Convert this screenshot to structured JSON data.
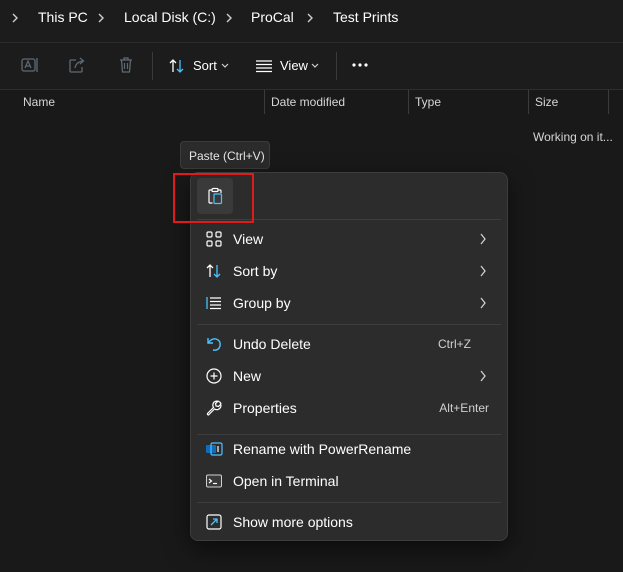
{
  "breadcrumb": {
    "items": [
      "This PC",
      "Local Disk (C:)",
      "ProCal",
      "Test Prints"
    ]
  },
  "toolbar": {
    "rename_icon": "rename-icon",
    "share_icon": "share-icon",
    "delete_icon": "delete-icon",
    "sort_label": "Sort",
    "view_label": "View",
    "more_icon": "more-icon"
  },
  "columns": {
    "name": "Name",
    "date_modified": "Date modified",
    "type": "Type",
    "size": "Size"
  },
  "status": {
    "working": "Working on it..."
  },
  "tooltip": {
    "text": "Paste (Ctrl+V)"
  },
  "context_menu": {
    "paste_icon": "paste-icon",
    "items": [
      {
        "label": "View",
        "icon": "view-grid-icon",
        "submenu": true
      },
      {
        "label": "Sort by",
        "icon": "sort-icon",
        "submenu": true
      },
      {
        "label": "Group by",
        "icon": "group-icon",
        "submenu": true
      },
      {
        "label": "Undo Delete",
        "icon": "undo-icon",
        "shortcut": "Ctrl+Z"
      },
      {
        "label": "New",
        "icon": "new-icon",
        "submenu": true
      },
      {
        "label": "Properties",
        "icon": "wrench-icon",
        "shortcut": "Alt+Enter"
      },
      {
        "label": "Rename with PowerRename",
        "icon": "powerrename-icon"
      },
      {
        "label": "Open in Terminal",
        "icon": "terminal-icon"
      },
      {
        "label": "Show more options",
        "icon": "show-more-icon"
      }
    ]
  },
  "colors": {
    "background": "#191919",
    "menu_background": "#2c2c2c",
    "accent_blue": "#4cc2ff",
    "highlight_red": "#e01b1b"
  }
}
